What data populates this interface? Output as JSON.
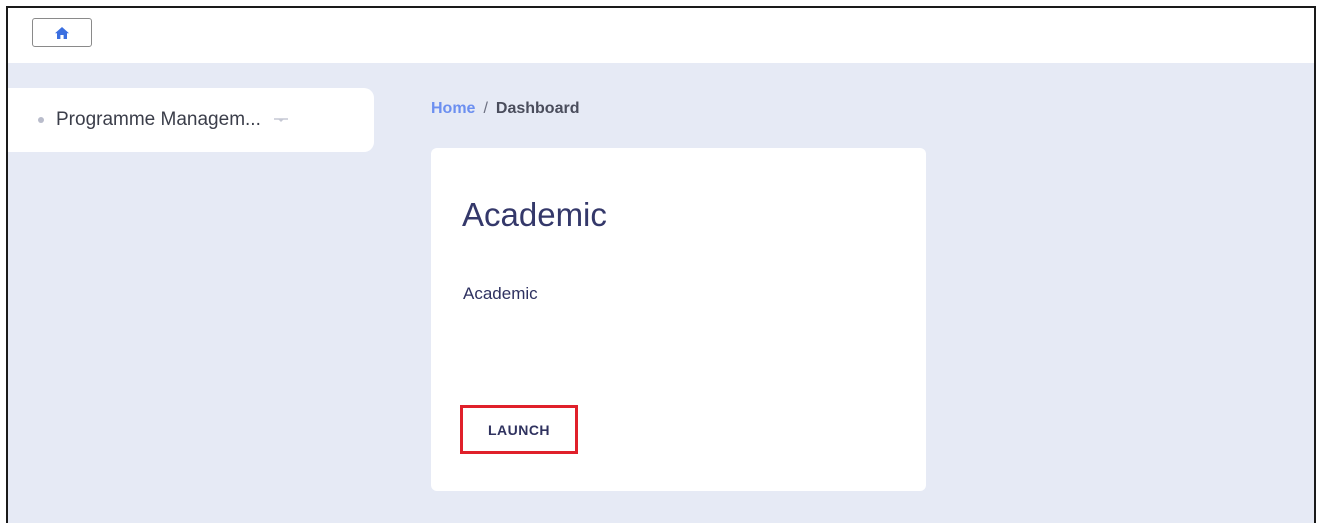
{
  "topbar": {
    "home_icon": "home-icon",
    "accent": "#3b6fe0"
  },
  "sidebar": {
    "menu_label": "Programme Managem...",
    "caret_icon": "caret-down-icon"
  },
  "breadcrumb": {
    "home": "Home",
    "separator": "/",
    "current": "Dashboard"
  },
  "card": {
    "title": "Academic",
    "description": "Academic",
    "action_label": "LAUNCH",
    "highlight_color": "#e0202a"
  }
}
